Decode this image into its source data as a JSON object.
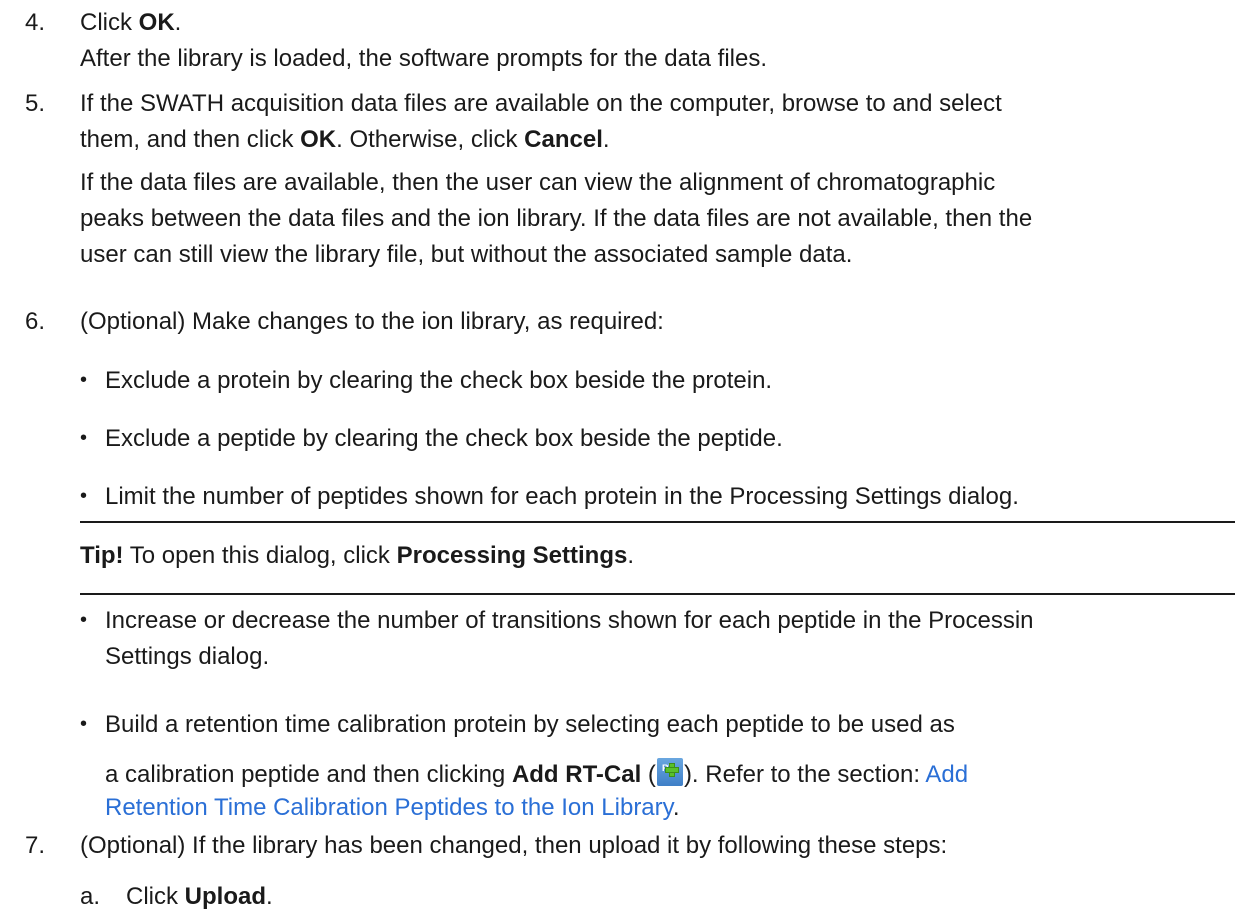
{
  "steps": {
    "s4": {
      "num": "4.",
      "line1_pre": "Click ",
      "line1_bold": "OK",
      "line1_post": ".",
      "line2": "After the library is loaded, the software prompts for the data files."
    },
    "s5": {
      "num": "5.",
      "line1": "If the SWATH acquisition data files are available on the computer, browse to and select",
      "line2_pre": "them, and then click ",
      "line2_bold1": "OK",
      "line2_mid": ". Otherwise, click ",
      "line2_bold2": "Cancel",
      "line2_post": ".",
      "para2_l1": "If the data files are available, then the user can view the alignment of chromatographic",
      "para2_l2": "peaks between the data files and the ion library. If the data files are not available, then the",
      "para2_l3": "user can still view the library file, but without the associated sample data."
    },
    "s6": {
      "num": "6.",
      "line1": "(Optional) Make changes to the ion library, as required:",
      "bullets": [
        "Exclude a protein by clearing the check box beside the protein.",
        "Exclude a peptide by clearing the check box beside the peptide.",
        "Limit the number of peptides shown for each protein in the Processing Settings dialog."
      ],
      "tip_bold": "Tip!",
      "tip_mid": " To open this dialog, click ",
      "tip_bold2": "Processing Settings",
      "tip_post": ".",
      "bullet4_l1": "Increase or decrease the number of transitions shown for each peptide in the Processin",
      "bullet4_l2": "Settings dialog.",
      "bullet5_l1": "Build a retention time calibration protein by selecting each peptide to be used as",
      "bullet5_l2_pre": "a calibration peptide and then clicking ",
      "bullet5_l2_bold": "Add RT-Cal",
      "bullet5_l2_paren_open": " (",
      "bullet5_l2_paren_close": "). Refer to the section: ",
      "bullet5_link_l1": "Add",
      "bullet5_link_l2": "Retention Time Calibration Peptides to the Ion Library",
      "bullet5_l3_post": ".",
      "rt_icon_label": "RT"
    },
    "s7": {
      "num": "7.",
      "line1": "(Optional) If the library has been changed, then upload it by following these steps:",
      "sub_a_num": "a.",
      "sub_a_pre": "Click ",
      "sub_a_bold": "Upload",
      "sub_a_post": "."
    }
  },
  "colors": {
    "text": "#1a1a1a",
    "link": "#2a6fd6"
  }
}
